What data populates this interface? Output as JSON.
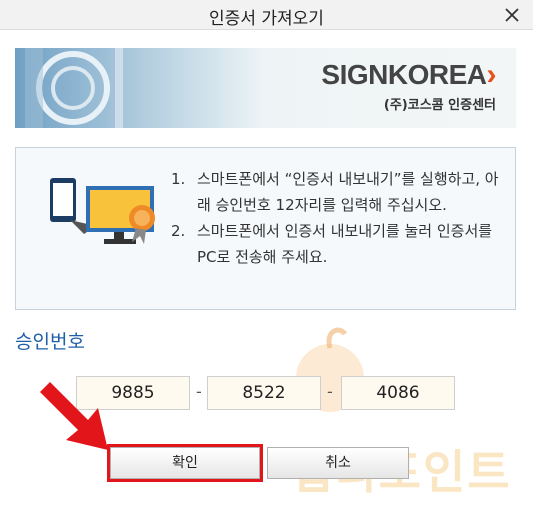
{
  "window": {
    "title": "인증서 가져오기"
  },
  "banner": {
    "brand_main": "SIGNKOREA",
    "brand_sub": "(주)코스콤 인증센터"
  },
  "instructions": [
    {
      "number": "1.",
      "text": "스마트폰에서 “인증서 내보내기”를 실행하고, 아래 승인번호 12자리를 입력해 주십시오."
    },
    {
      "number": "2.",
      "text": "스마트폰에서 인증서 내보내기를 눌러 인증서를 PC로 전송해 주세요."
    }
  ],
  "approval": {
    "label": "승인번호",
    "codes": [
      "9885",
      "8522",
      "4086"
    ],
    "separator": "-"
  },
  "buttons": {
    "ok": "확인",
    "cancel": "취소"
  },
  "watermark": {
    "text": "랩리포인트"
  },
  "colors": {
    "label_blue": "#1f5fa8",
    "highlight_red": "#e2151b",
    "brand_orange": "#e8501a"
  },
  "icons": {
    "close": "close-icon",
    "transfer": "phone-to-pc-certificate-icon",
    "arrow": "red-arrow-annotation"
  }
}
